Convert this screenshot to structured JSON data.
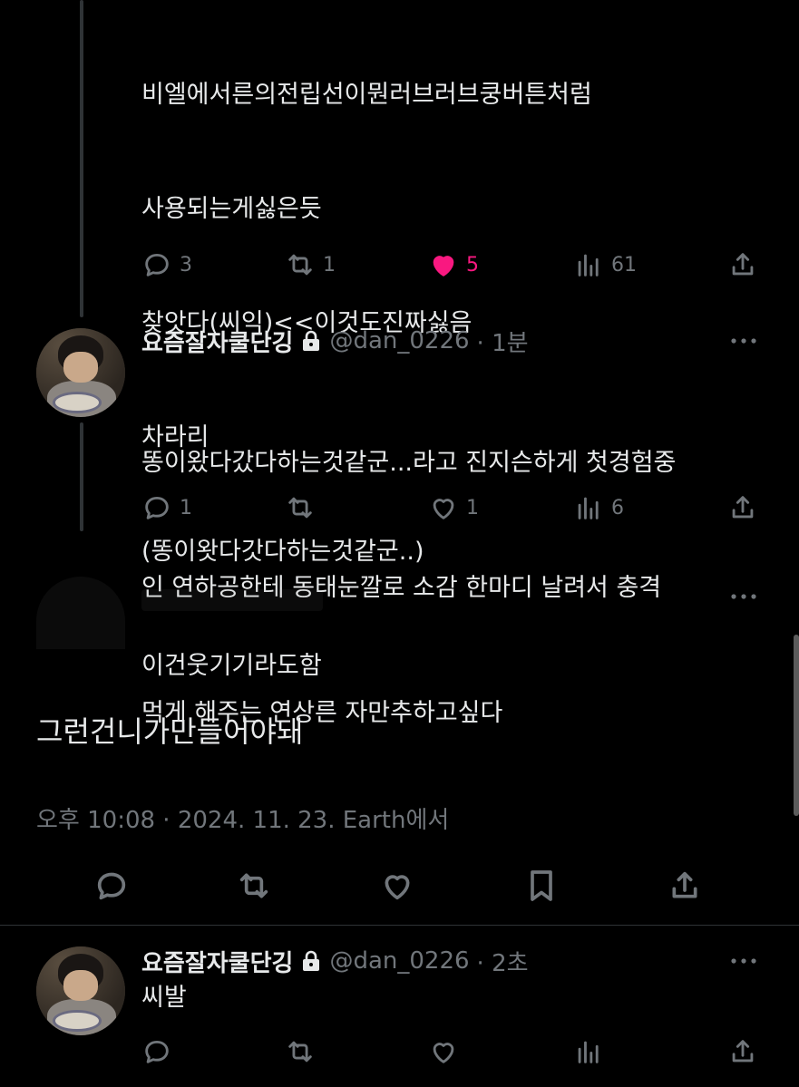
{
  "top_tweet": {
    "lines": [
      "비엘에서른의전립선이뭔러브러브쿵버튼처럼",
      "사용되는게싫은듯",
      "찾앗다(씨익)<<이것도진짜싫음",
      "차라리",
      "(똥이왓다갓다하는것같군..)",
      "이건웃기기라도함"
    ],
    "reply_count": "3",
    "retweet_count": "1",
    "like_count": "5",
    "view_count": "61",
    "liked": true
  },
  "reply_tweet": {
    "display_name": "요즘잘자쿨단깅",
    "handle": "@dan_0226",
    "time": "· 1분",
    "text_lines": [
      "똥이왔다갔다하는것같군...라고 진지슨하게 첫경험중",
      "인 연하공한테 동태눈깔로 소감 한마디 날려서 충격",
      "먹게 해주는 연상른 자만추하고싶다"
    ],
    "reply_count": "1",
    "retweet_count": "",
    "like_count": "1",
    "view_count": "6"
  },
  "main_tweet": {
    "text": "그런건니가만들어야돼",
    "timestamp": "오후 10:08 · 2024. 11. 23. Earth에서"
  },
  "last_tweet": {
    "display_name": "요즘잘자쿨단깅",
    "handle": "@dan_0226",
    "time": "· 2초",
    "text": "씨발"
  },
  "icons": {
    "reply": "reply-icon",
    "retweet": "retweet-icon",
    "like": "heart-icon",
    "views": "views-icon",
    "share": "share-icon",
    "bookmark": "bookmark-icon",
    "lock": "lock-icon",
    "more": "more-icon"
  },
  "colors": {
    "background": "#000000",
    "text": "#e7e9ea",
    "secondary": "#71767b",
    "like": "#f91880",
    "divider": "#2f3336"
  }
}
